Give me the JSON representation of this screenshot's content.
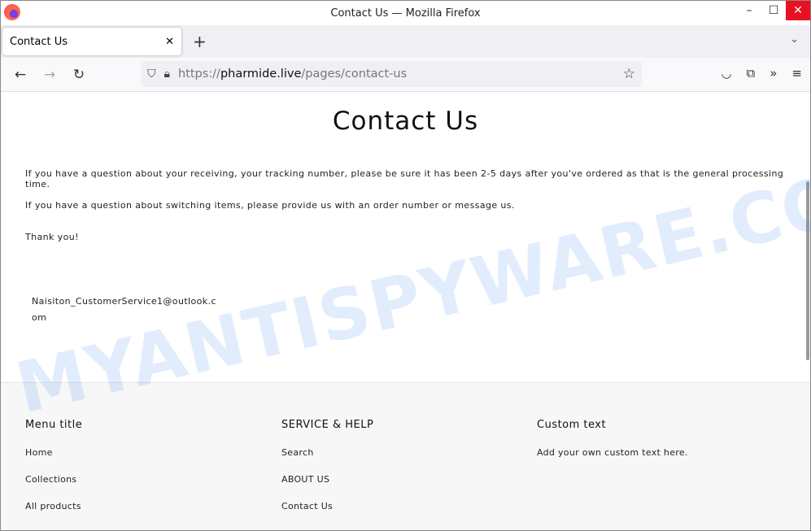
{
  "window": {
    "title": "Contact Us — Mozilla Firefox"
  },
  "tab": {
    "label": "Contact Us"
  },
  "url": {
    "scheme": "https://",
    "host": "pharmide.live",
    "path": "/pages/contact-us"
  },
  "page": {
    "title": "Contact Us",
    "paragraphs": [
      "If you have a question about your receiving, your tracking number, please be sure it has been 2-5 days after you've ordered as that is the general processing time.",
      "If you have a question about switching items, please provide us with an order number or message us.",
      "Thank you!"
    ],
    "email_line1": "Naisiton_CustomerService1@outlook.c",
    "email_line2": "om"
  },
  "footer": {
    "col1": {
      "title": "Menu title",
      "links": [
        "Home",
        "Collections",
        "All products"
      ]
    },
    "col2": {
      "title": "SERVICE & HELP",
      "links": [
        "Search",
        "ABOUT US",
        "Contact Us"
      ]
    },
    "col3": {
      "title": "Custom text",
      "text": "Add your own custom text here."
    }
  },
  "watermark": "MYANTISPYWARE.COM"
}
